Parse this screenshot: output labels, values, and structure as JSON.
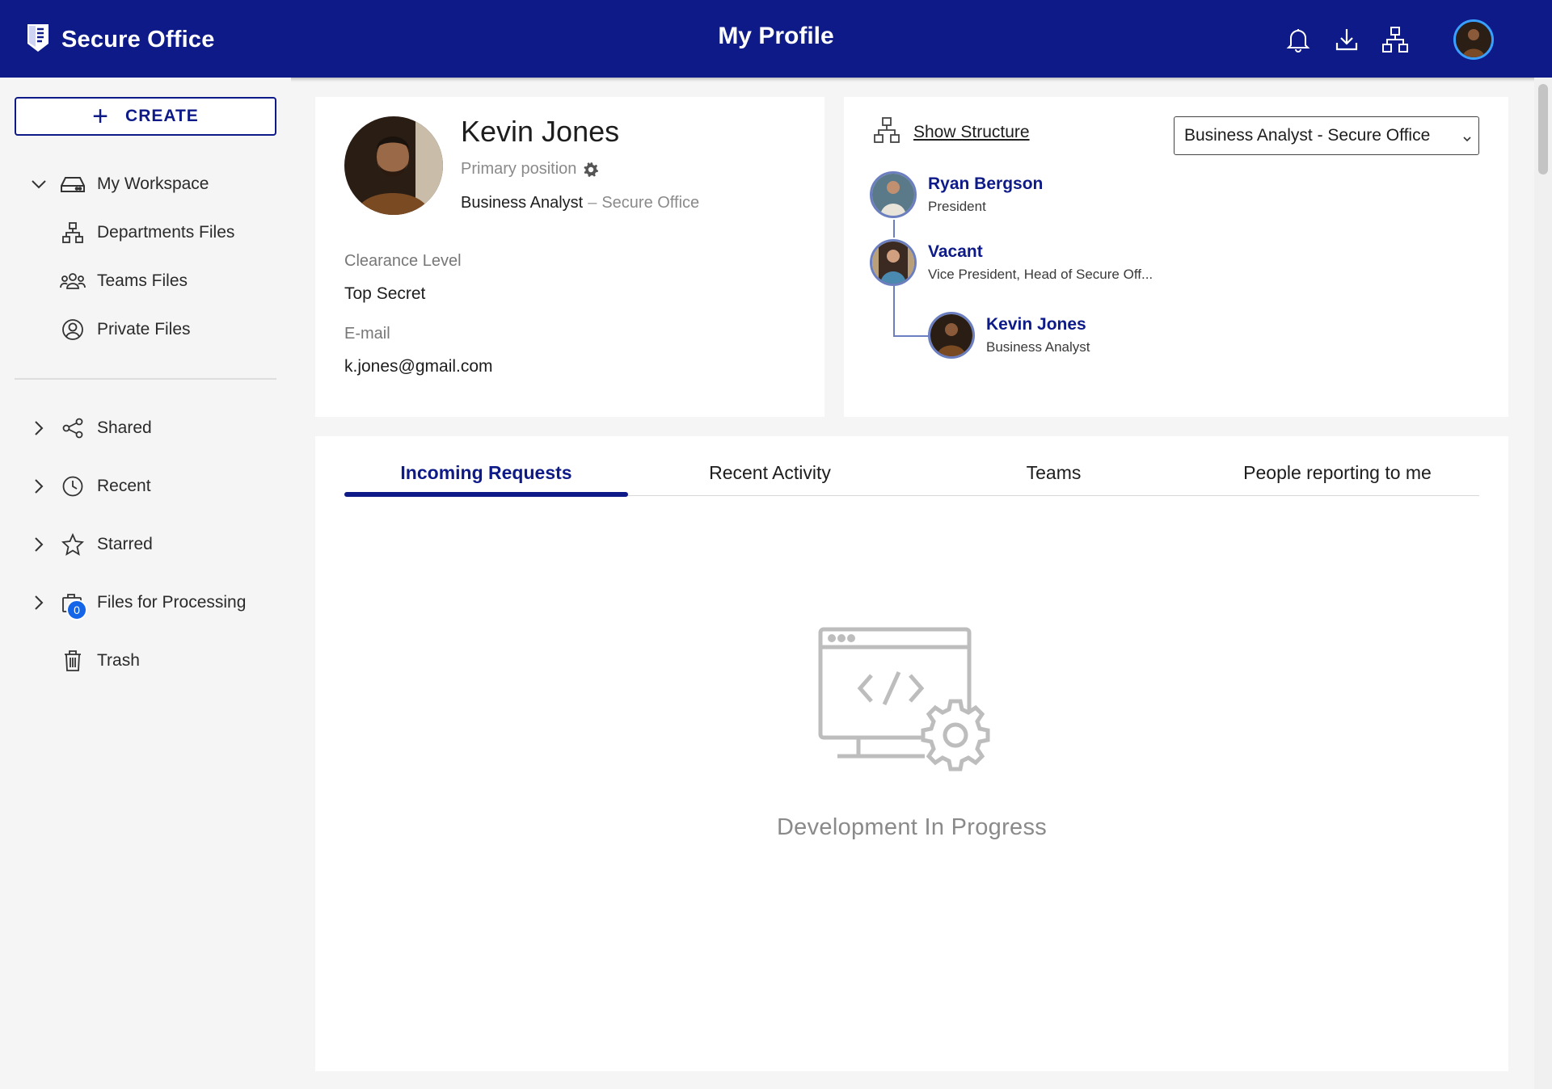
{
  "header": {
    "brand_name": "Secure Office",
    "page_title": "My Profile",
    "icons": [
      "bell-icon",
      "download-icon",
      "org-structure-icon"
    ],
    "brand_color": "#0d1a87"
  },
  "sidebar": {
    "create_label": "CREATE",
    "items": [
      {
        "label": "My Workspace",
        "icon": "drive-icon",
        "chevron": "down"
      },
      {
        "label": "Departments Files",
        "icon": "hierarchy-icon"
      },
      {
        "label": "Teams Files",
        "icon": "team-icon"
      },
      {
        "label": "Private Files",
        "icon": "user-circle-icon"
      },
      {
        "label": "Shared",
        "icon": "share-icon",
        "chevron": "right"
      },
      {
        "label": "Recent",
        "icon": "clock-icon",
        "chevron": "right"
      },
      {
        "label": "Starred",
        "icon": "star-icon",
        "chevron": "right"
      },
      {
        "label": "Files for Processing",
        "icon": "briefcase-icon",
        "chevron": "right",
        "badge": "0"
      },
      {
        "label": "Trash",
        "icon": "trash-icon"
      }
    ]
  },
  "profile": {
    "name": "Kevin Jones",
    "primary_position_label": "Primary position",
    "role": "Business Analyst",
    "org": "Secure Office",
    "dash": "–",
    "clearance_label": "Clearance Level",
    "clearance_value": "Top Secret",
    "email_label": "E-mail",
    "email_value": "k.jones@gmail.com"
  },
  "structure": {
    "show_label": "Show Structure",
    "selected_position": "Business Analyst - Secure Office",
    "nodes": [
      {
        "name": "Ryan Bergson",
        "position": "President"
      },
      {
        "name": "Vacant",
        "position": "Vice President, Head of Secure Off..."
      },
      {
        "name": "Kevin Jones",
        "position": "Business Analyst"
      }
    ]
  },
  "tabs": {
    "items": [
      "Incoming Requests",
      "Recent Activity",
      "Teams",
      "People reporting to me"
    ],
    "active": 0,
    "empty_message": "Development In Progress"
  }
}
